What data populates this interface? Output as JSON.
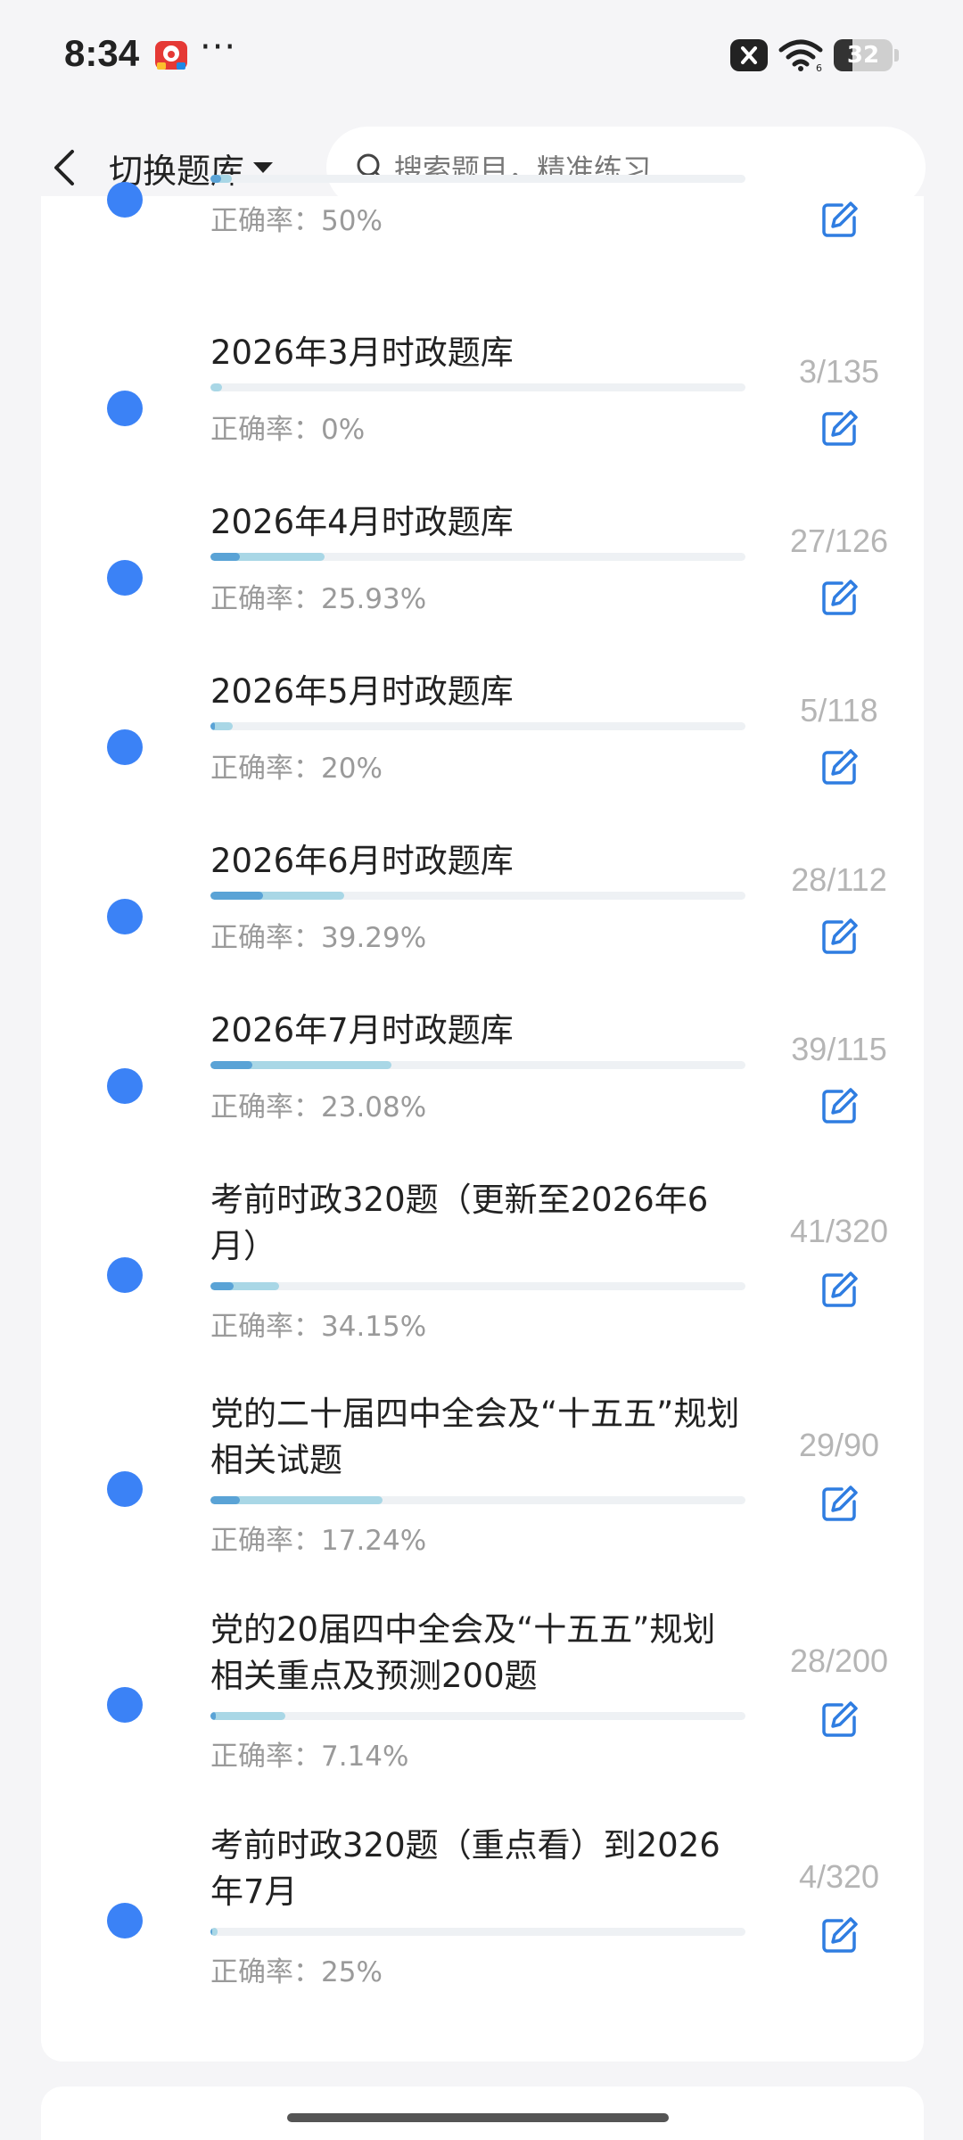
{
  "status_bar": {
    "time": "8:34",
    "dots": "···",
    "battery": "32",
    "battery_level": 0.32,
    "icons": [
      "app-notification-icon",
      "close-box-icon",
      "wifi-icon",
      "battery-icon"
    ]
  },
  "header": {
    "switch_label": "切换题库",
    "search_placeholder": "搜索题目，精准练习",
    "icons": [
      "back-arrow-icon",
      "caret-down-icon",
      "search-icon"
    ]
  },
  "colors": {
    "accent": "#3b82f6",
    "progress_correct": "#5aa3d6",
    "progress_done": "#a9d7e6",
    "muted_text": "#9a9a9a"
  },
  "accuracy_prefix": "正确率：",
  "items": [
    {
      "title": "",
      "count": "",
      "accuracy": "50%",
      "progress": 0.04,
      "correct_ratio": 0.5
    },
    {
      "title": "2026年3月时政题库",
      "count": "3/135",
      "accuracy": "0%",
      "progress": 0.022,
      "correct_ratio": 0.0
    },
    {
      "title": "2026年4月时政题库",
      "count": "27/126",
      "accuracy": "25.93%",
      "progress": 0.214,
      "correct_ratio": 0.2593
    },
    {
      "title": "2026年5月时政题库",
      "count": "5/118",
      "accuracy": "20%",
      "progress": 0.042,
      "correct_ratio": 0.2
    },
    {
      "title": "2026年6月时政题库",
      "count": "28/112",
      "accuracy": "39.29%",
      "progress": 0.25,
      "correct_ratio": 0.3929
    },
    {
      "title": "2026年7月时政题库",
      "count": "39/115",
      "accuracy": "23.08%",
      "progress": 0.339,
      "correct_ratio": 0.2308
    },
    {
      "title": "考前时政320题（更新至2026年6月）",
      "count": "41/320",
      "accuracy": "34.15%",
      "progress": 0.128,
      "correct_ratio": 0.3415
    },
    {
      "title": "党的二十届四中全会及“十五五”规划相关试题",
      "count": "29/90",
      "accuracy": "17.24%",
      "progress": 0.322,
      "correct_ratio": 0.1724
    },
    {
      "title": "党的20届四中全会及“十五五”规划相关重点及预测200题",
      "count": "28/200",
      "accuracy": "7.14%",
      "progress": 0.14,
      "correct_ratio": 0.0714
    },
    {
      "title": "考前时政320题（重点看）到2026年7月",
      "count": "4/320",
      "accuracy": "25%",
      "progress": 0.0125,
      "correct_ratio": 0.25
    }
  ]
}
